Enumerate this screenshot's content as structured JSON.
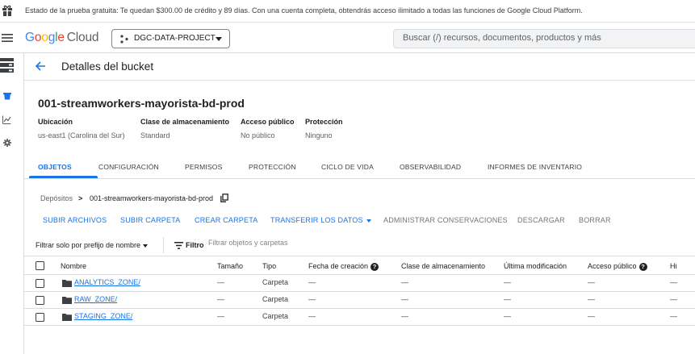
{
  "banner": {
    "text": "Estado de la prueba gratuita: Te quedan $300.00 de crédito y 89 días. Con una cuenta completa, obtendrás acceso ilimitado a todas las funciones de Google Cloud Platform."
  },
  "header": {
    "logo_google": [
      "G",
      "o",
      "o",
      "g",
      "l",
      "e"
    ],
    "logo_cloud": "Cloud",
    "project_name": "DGC-DATA-PROJECT",
    "search_placeholder": "Buscar (/) recursos, documentos, productos y más"
  },
  "page": {
    "title": "Detalles del bucket",
    "bucket_name": "001-streamworkers-mayorista-bd-prod"
  },
  "meta": [
    {
      "label": "Ubicación",
      "value": "us-east1 (Carolina del Sur)"
    },
    {
      "label": "Clase de almacenamiento",
      "value": "Standard"
    },
    {
      "label": "Acceso público",
      "value": "No público"
    },
    {
      "label": "Protección",
      "value": "Ninguno"
    }
  ],
  "tabs": [
    {
      "label": "OBJETOS",
      "active": true
    },
    {
      "label": "CONFIGURACIÓN",
      "active": false
    },
    {
      "label": "PERMISOS",
      "active": false
    },
    {
      "label": "PROTECCIÓN",
      "active": false
    },
    {
      "label": "CICLO DE VIDA",
      "active": false
    },
    {
      "label": "OBSERVABILIDAD",
      "active": false
    },
    {
      "label": "INFORMES DE INVENTARIO",
      "active": false
    }
  ],
  "breadcrumb": {
    "root": "Depósitos",
    "separator": ">",
    "current": "001-streamworkers-mayorista-bd-prod"
  },
  "actions": [
    {
      "label": "SUBIR ARCHIVOS",
      "enabled": true
    },
    {
      "label": "SUBIR CARPETA",
      "enabled": true
    },
    {
      "label": "CREAR CARPETA",
      "enabled": true
    },
    {
      "label": "TRANSFERIR LOS DATOS",
      "enabled": true
    },
    {
      "label": "ADMINISTRAR CONSERVACIONES",
      "enabled": false
    },
    {
      "label": "DESCARGAR",
      "enabled": false
    },
    {
      "label": "BORRAR",
      "enabled": false
    }
  ],
  "filter": {
    "select_label": "Filtrar solo por prefijo de nombre",
    "label": "Filtro",
    "placeholder": "Filtrar objetos y carpetas"
  },
  "table": {
    "columns": [
      "Nombre",
      "Tamaño",
      "Tipo",
      "Fecha de creación",
      "Clase de almacenamiento",
      "Última modificación",
      "Acceso público",
      "Hi"
    ],
    "rows": [
      {
        "name": "ANALYTICS_ZONE/",
        "size": "—",
        "type": "Carpeta",
        "created": "—",
        "storage_class": "—",
        "modified": "—",
        "public_access": "—",
        "extra": "—"
      },
      {
        "name": "RAW_ZONE/",
        "size": "—",
        "type": "Carpeta",
        "created": "—",
        "storage_class": "—",
        "modified": "—",
        "public_access": "—",
        "extra": "—"
      },
      {
        "name": "STAGING_ZONE/",
        "size": "—",
        "type": "Carpeta",
        "created": "—",
        "storage_class": "—",
        "modified": "—",
        "public_access": "—",
        "extra": "—"
      }
    ]
  },
  "help_glyph": "?",
  "colors": {
    "accent": "#1a73e8",
    "text": "#202124",
    "muted": "#5f6368",
    "disabled": "#70757a",
    "divider": "#dadce0",
    "rail_active": "#1a73e8"
  },
  "icons": {
    "banner": "gift-icon",
    "menu": "hamburger-icon",
    "project": "project-dots-icon",
    "back": "arrow-back-icon",
    "copy": "copy-icon",
    "filter": "filter-lines-icon",
    "folder": "folder-icon"
  }
}
